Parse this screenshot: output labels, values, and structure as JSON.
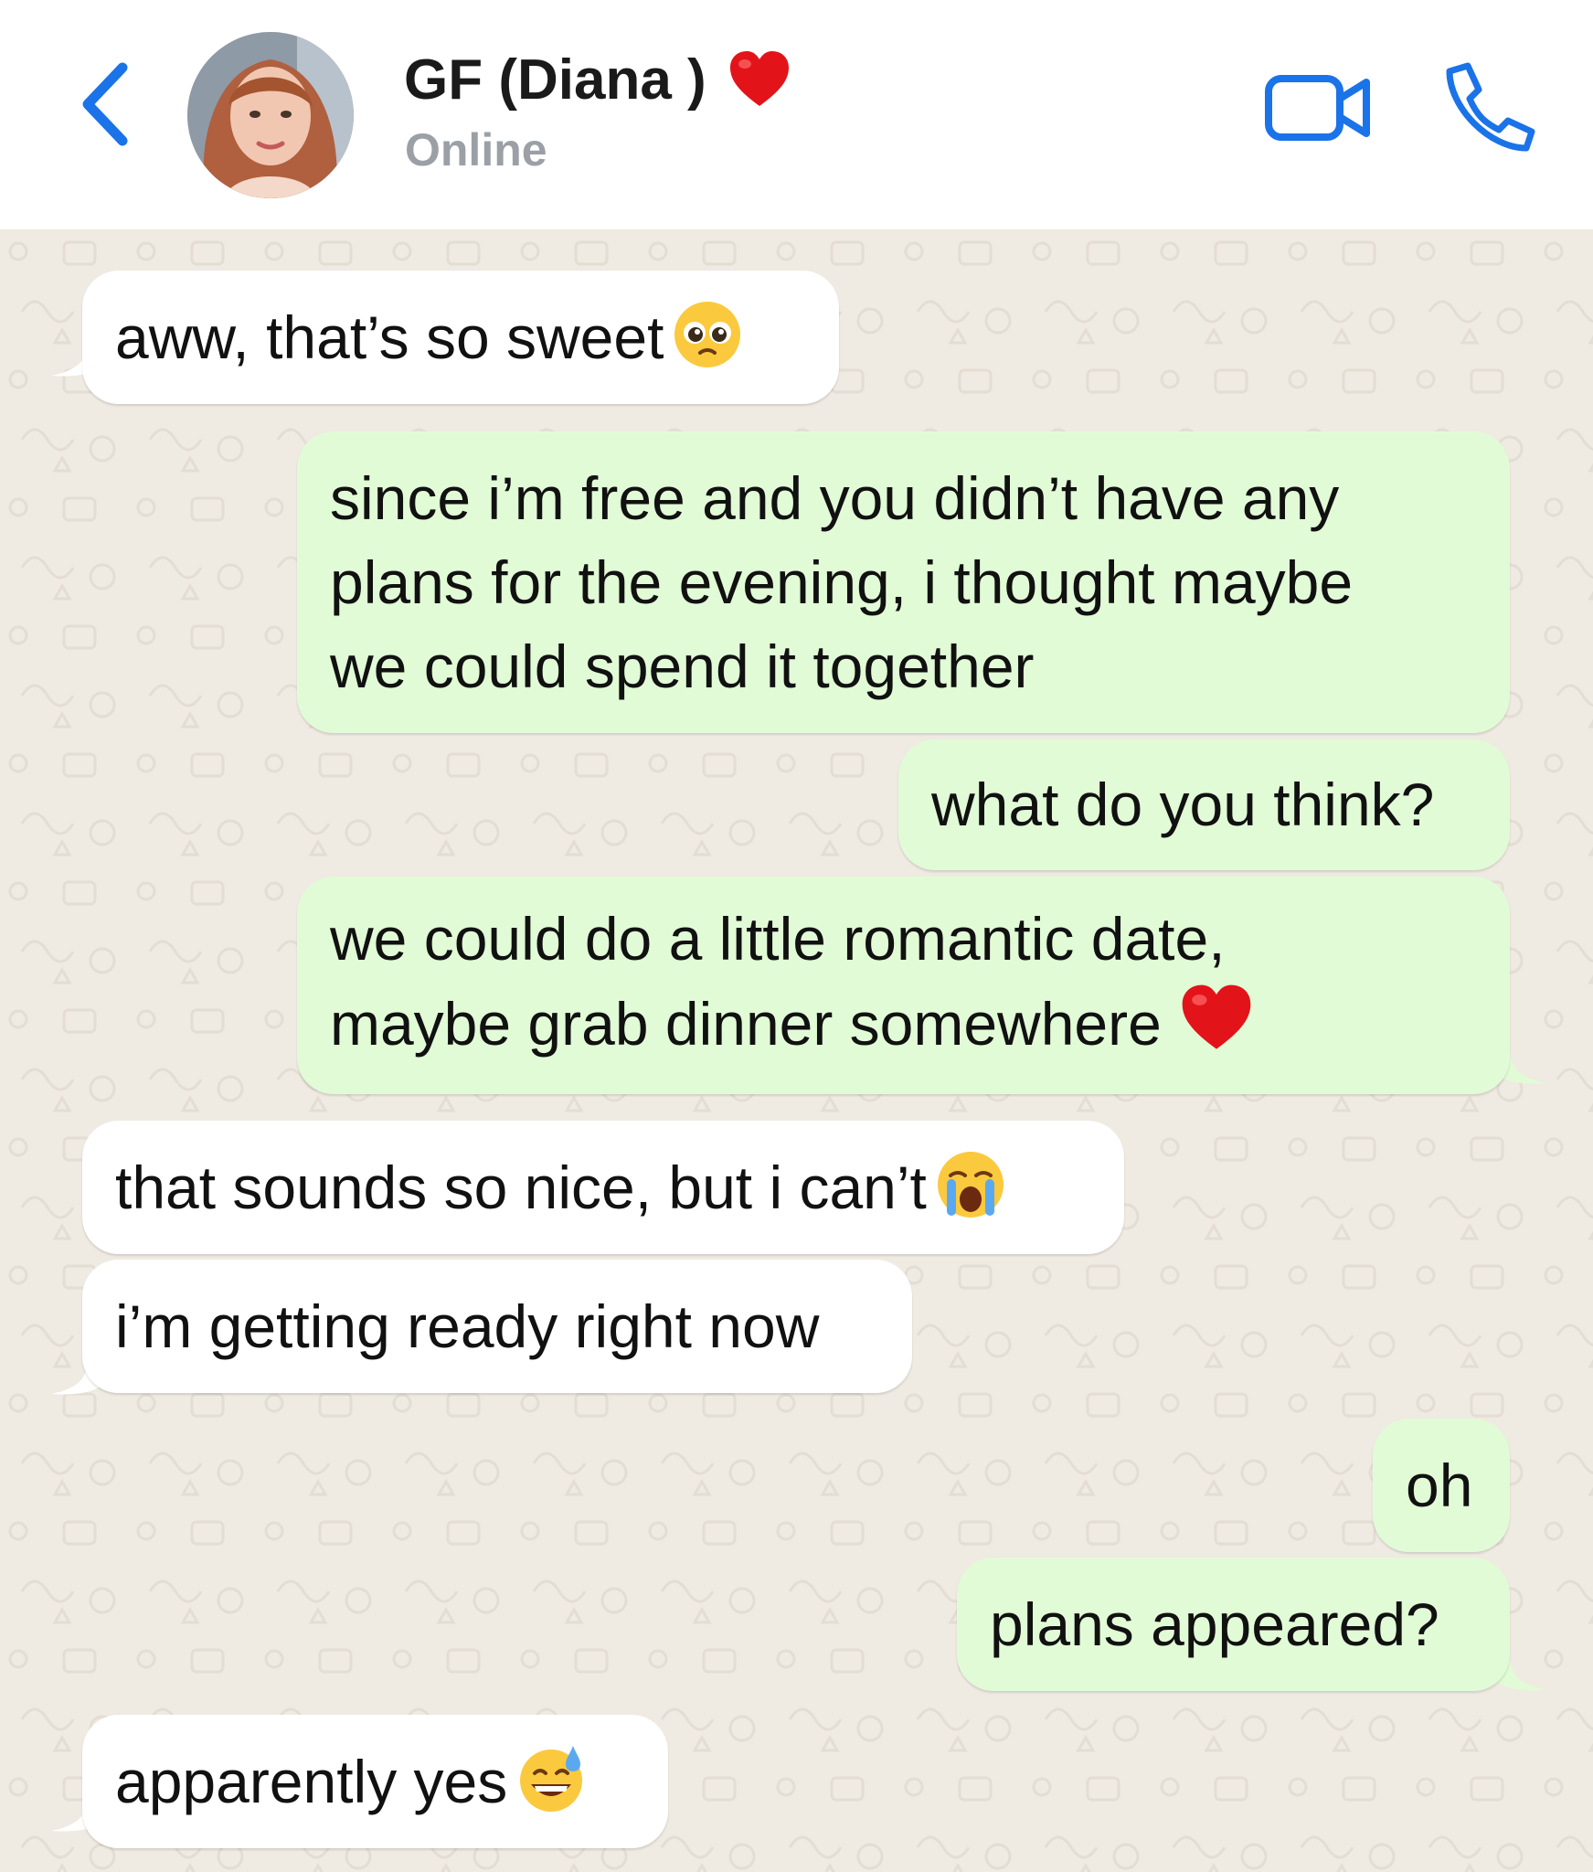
{
  "header": {
    "contact_name": "GF (Diana )",
    "status": "Online",
    "back_icon": "chevron-left-icon",
    "video_icon": "video-camera-icon",
    "call_icon": "phone-icon",
    "name_emoji": "red-heart",
    "accent_color": "#1a73e8"
  },
  "messages": [
    {
      "direction": "incoming",
      "text": "aww, that’s so sweet",
      "emoji": "pleading-face"
    },
    {
      "direction": "outgoing",
      "lines": [
        "since i’m free and you didn’t have any",
        "plans for the evening, i thought maybe",
        "we could spend it together"
      ]
    },
    {
      "direction": "outgoing",
      "text": "what do you think?"
    },
    {
      "direction": "outgoing",
      "lines": [
        "we could do a little romantic date,",
        "maybe grab dinner somewhere"
      ],
      "emoji": "red-heart"
    },
    {
      "direction": "incoming",
      "text": "that sounds so nice, but i can’t",
      "emoji": "loudly-crying-face"
    },
    {
      "direction": "incoming",
      "text": "i’m getting ready right now"
    },
    {
      "direction": "outgoing",
      "text": "oh"
    },
    {
      "direction": "outgoing",
      "text": "plans appeared?"
    },
    {
      "direction": "incoming",
      "text": "apparently yes",
      "emoji": "grinning-face-with-sweat"
    }
  ],
  "colors": {
    "incoming_bubble": "#ffffff",
    "outgoing_bubble": "#e2fbd7",
    "chat_background": "#efeae2"
  }
}
